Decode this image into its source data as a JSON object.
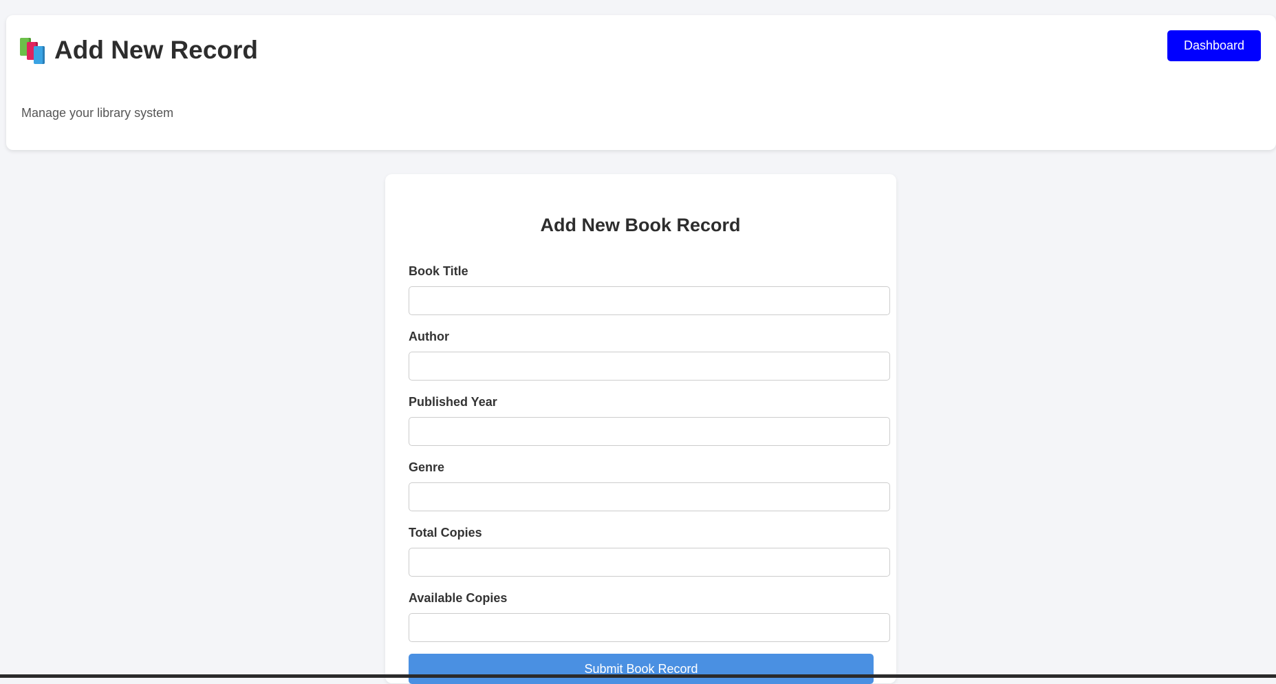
{
  "header": {
    "title": "Add New Record",
    "title_icon": "books-icon",
    "subtitle": "Manage your library system",
    "dashboard_label": "Dashboard"
  },
  "form": {
    "title": "Add New Book Record",
    "fields": [
      {
        "label": "Book Title",
        "value": "",
        "placeholder": ""
      },
      {
        "label": "Author",
        "value": "",
        "placeholder": ""
      },
      {
        "label": "Published Year",
        "value": "",
        "placeholder": ""
      },
      {
        "label": "Genre",
        "value": "",
        "placeholder": ""
      },
      {
        "label": "Total Copies",
        "value": "",
        "placeholder": ""
      },
      {
        "label": "Available Copies",
        "value": "",
        "placeholder": ""
      }
    ],
    "submit_label": "Submit Book Record"
  },
  "colors": {
    "page_background": "#f4f5f8",
    "dashboard_button": "#0000ff",
    "submit_button": "#4a90e2",
    "card_background": "#ffffff"
  }
}
